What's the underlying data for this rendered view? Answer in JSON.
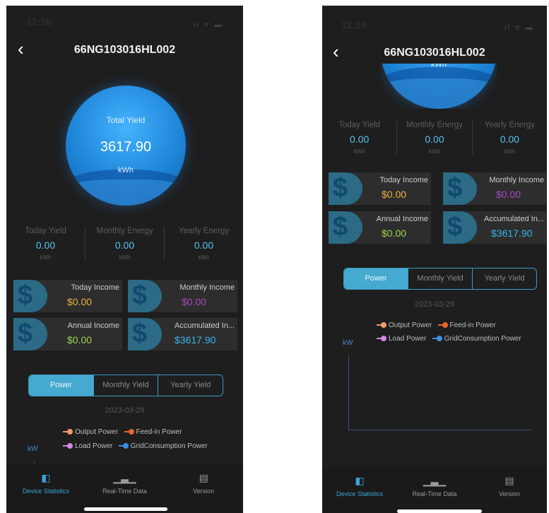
{
  "status": {
    "time": "12:18",
    "icons": "ıl ᯤ ▬"
  },
  "header": {
    "back_icon": "chevron-left-icon",
    "title": "66NG103016HL002"
  },
  "total_yield": {
    "label": "Total Yield",
    "value": "3617.90",
    "unit": "kWh",
    "unit_partial": "kWh"
  },
  "stats": [
    {
      "label": "Today Yield",
      "value": "0.00",
      "unit": "kWh"
    },
    {
      "label": "Monthly Energy",
      "value": "0.00",
      "unit": "kWh"
    },
    {
      "label": "Yearly Energy",
      "value": "0.00",
      "unit": "kWh"
    }
  ],
  "income": {
    "today": {
      "label": "Today Income",
      "value": "$0.00",
      "color": "#e7b43b"
    },
    "monthly": {
      "label": "Monthly Income",
      "value": "$0.00",
      "color": "#a24bbd"
    },
    "annual": {
      "label": "Annual Income",
      "value": "$0.00",
      "color": "#9fd24b"
    },
    "accumulated": {
      "label": "Accumulated In...",
      "value": "$3617.90",
      "color": "#38b6ea"
    },
    "icon": "$"
  },
  "segments": [
    "Power",
    "Monthly Yield",
    "Yearly Yield"
  ],
  "date": "2023-03-29",
  "legend": [
    {
      "name": "Output Power",
      "color": "#f29b6a"
    },
    {
      "name": "Feed-in Power",
      "color": "#e7642d"
    },
    {
      "name": "Load Power",
      "color": "#d487e3"
    },
    {
      "name": "GridConsumption Power",
      "color": "#3c8fe0"
    }
  ],
  "chart": {
    "ylabel": "kW"
  },
  "tabs": [
    {
      "label": "Device Statistics",
      "icon": "◧"
    },
    {
      "label": "Real-Time Data",
      "icon": "▁▃▁"
    },
    {
      "label": "Version",
      "icon": "▤"
    }
  ],
  "colors": {
    "accent": "#46a9d0",
    "background": "#1e1e1e"
  }
}
